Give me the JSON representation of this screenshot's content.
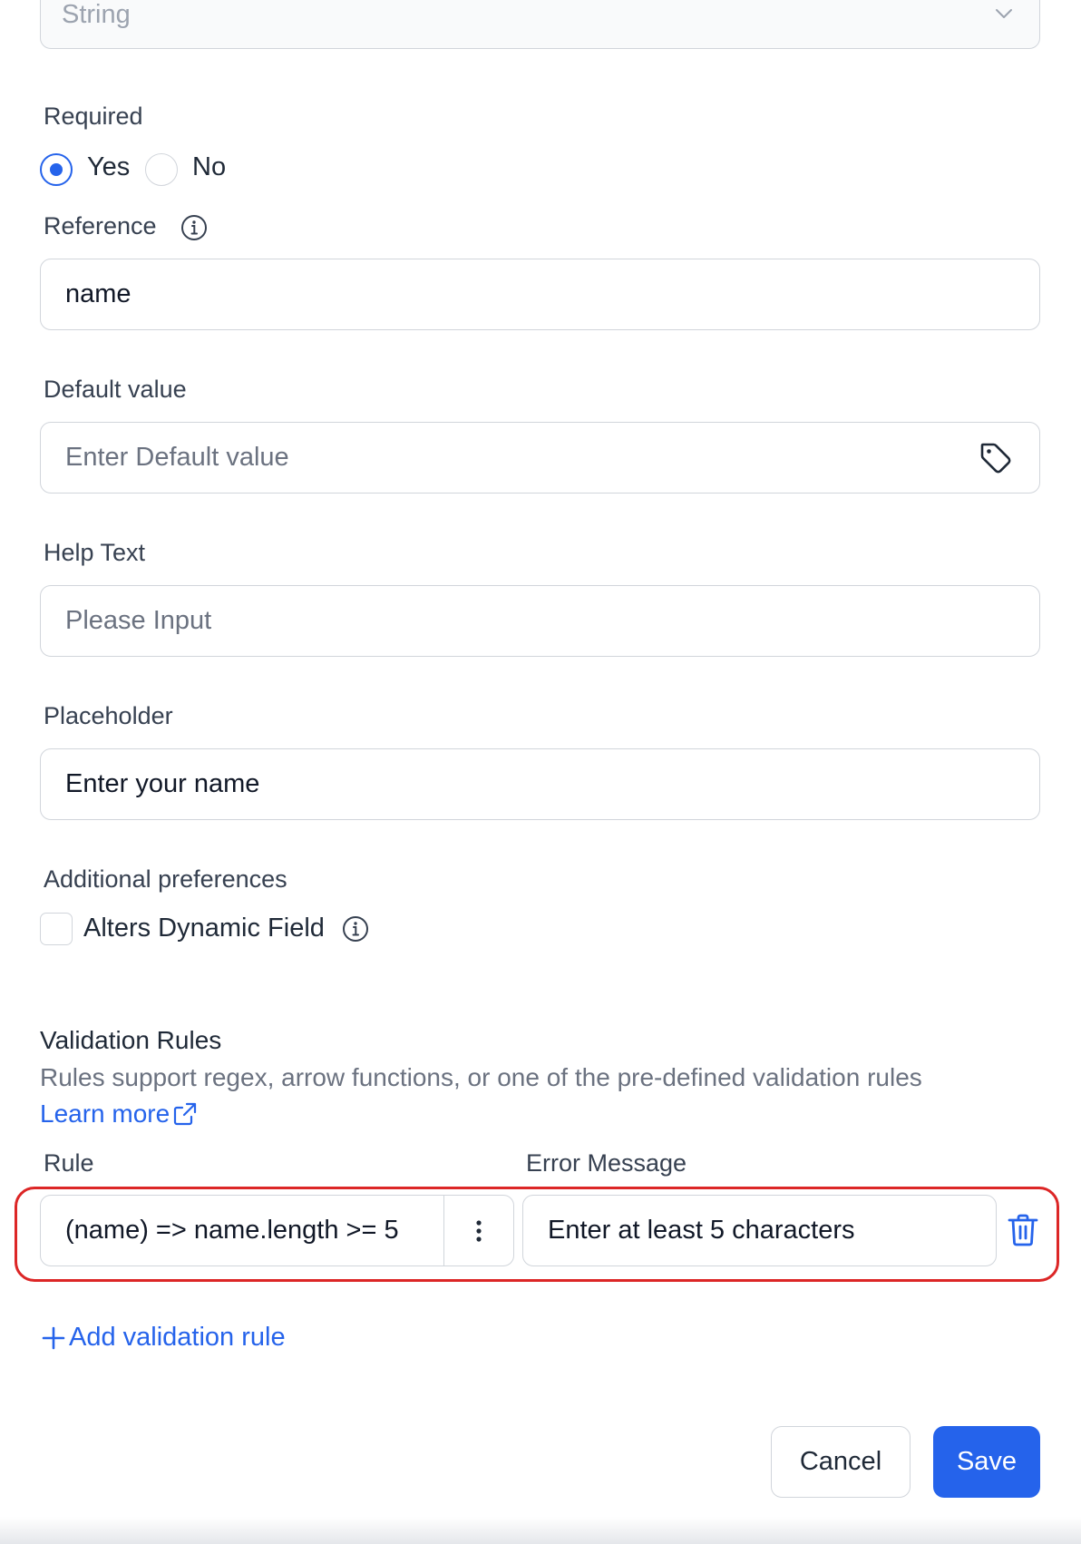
{
  "type_field": {
    "value": "String"
  },
  "required": {
    "label": "Required",
    "options": [
      {
        "label": "Yes",
        "checked": true
      },
      {
        "label": "No",
        "checked": false
      }
    ]
  },
  "reference": {
    "label": "Reference",
    "value": "name"
  },
  "default_value": {
    "label": "Default value",
    "placeholder": "Enter Default value"
  },
  "help_text": {
    "label": "Help Text",
    "placeholder": "Please Input"
  },
  "placeholder_field": {
    "label": "Placeholder",
    "value": "Enter your name"
  },
  "additional": {
    "label": "Additional preferences",
    "checkbox_label": "Alters Dynamic Field"
  },
  "validation": {
    "title": "Validation Rules",
    "description": "Rules support regex, arrow functions, or one of the pre-defined validation rules",
    "learn_more": "Learn more",
    "rule_header": "Rule",
    "error_header": "Error Message",
    "rules": [
      {
        "rule": "(name) => name.length >= 5",
        "error": "Enter at least 5 characters"
      }
    ],
    "add_label": "Add validation rule"
  },
  "footer": {
    "cancel": "Cancel",
    "save": "Save"
  },
  "colors": {
    "accent": "#2563eb",
    "highlight": "#dc2626"
  }
}
